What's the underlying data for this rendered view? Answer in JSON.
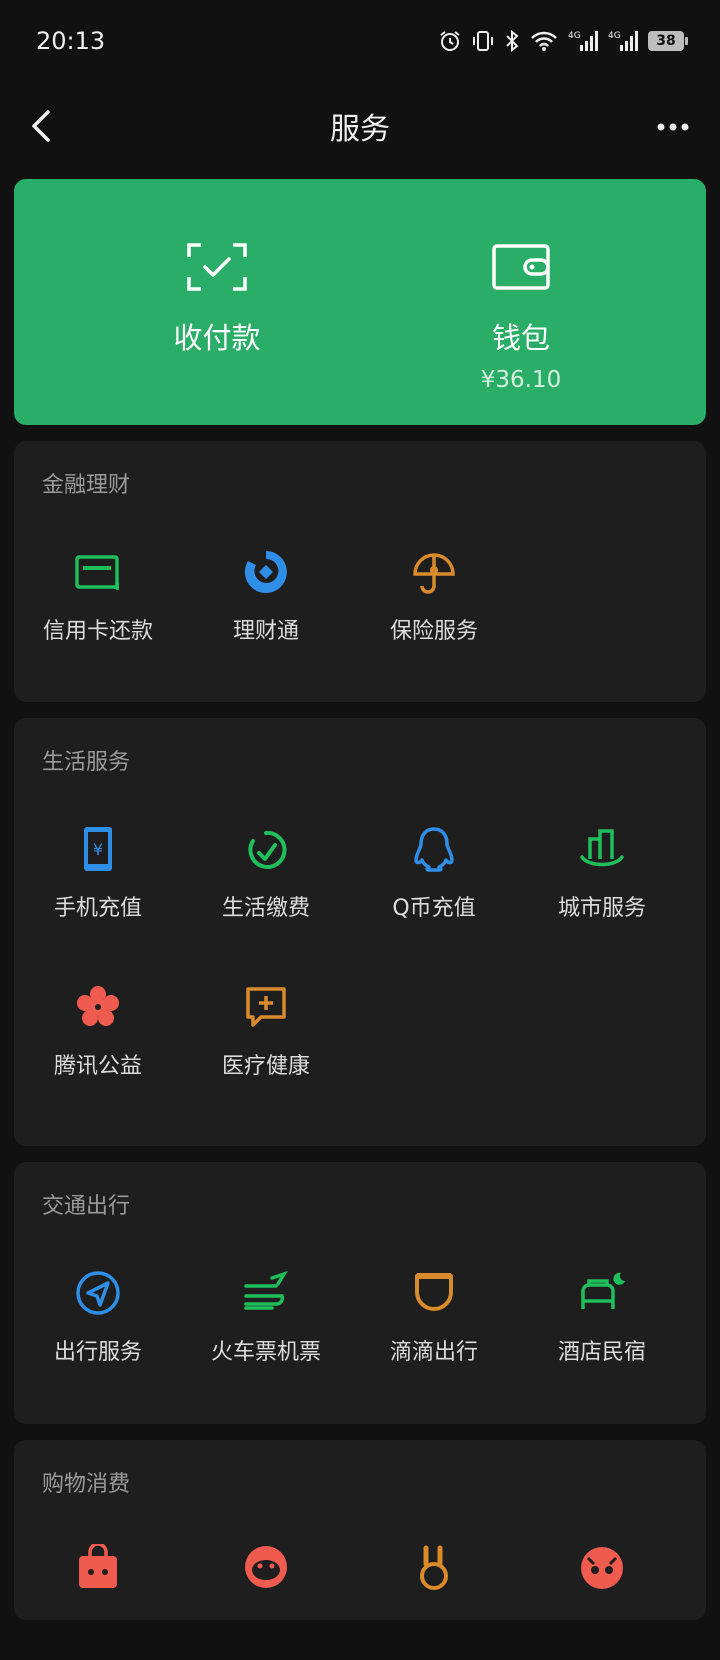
{
  "status_bar": {
    "time": "20:13",
    "battery": "38"
  },
  "nav": {
    "title": "服务"
  },
  "hero": {
    "pay": {
      "label": "收付款"
    },
    "wallet": {
      "label": "钱包",
      "balance": "¥36.10"
    }
  },
  "sections": {
    "finance": {
      "title": "金融理财",
      "items": [
        "信用卡还款",
        "理财通",
        "保险服务"
      ]
    },
    "life": {
      "title": "生活服务",
      "items": [
        "手机充值",
        "生活缴费",
        "Q币充值",
        "城市服务",
        "腾讯公益",
        "医疗健康"
      ]
    },
    "travel": {
      "title": "交通出行",
      "items": [
        "出行服务",
        "火车票机票",
        "滴滴出行",
        "酒店民宿"
      ]
    },
    "shopping": {
      "title": "购物消费"
    }
  },
  "colors": {
    "accent_green": "#2aad67",
    "icon_green": "#1fbf5c",
    "icon_blue": "#2f8ee6",
    "icon_orange": "#d98a2b",
    "icon_red": "#f05b4f"
  }
}
